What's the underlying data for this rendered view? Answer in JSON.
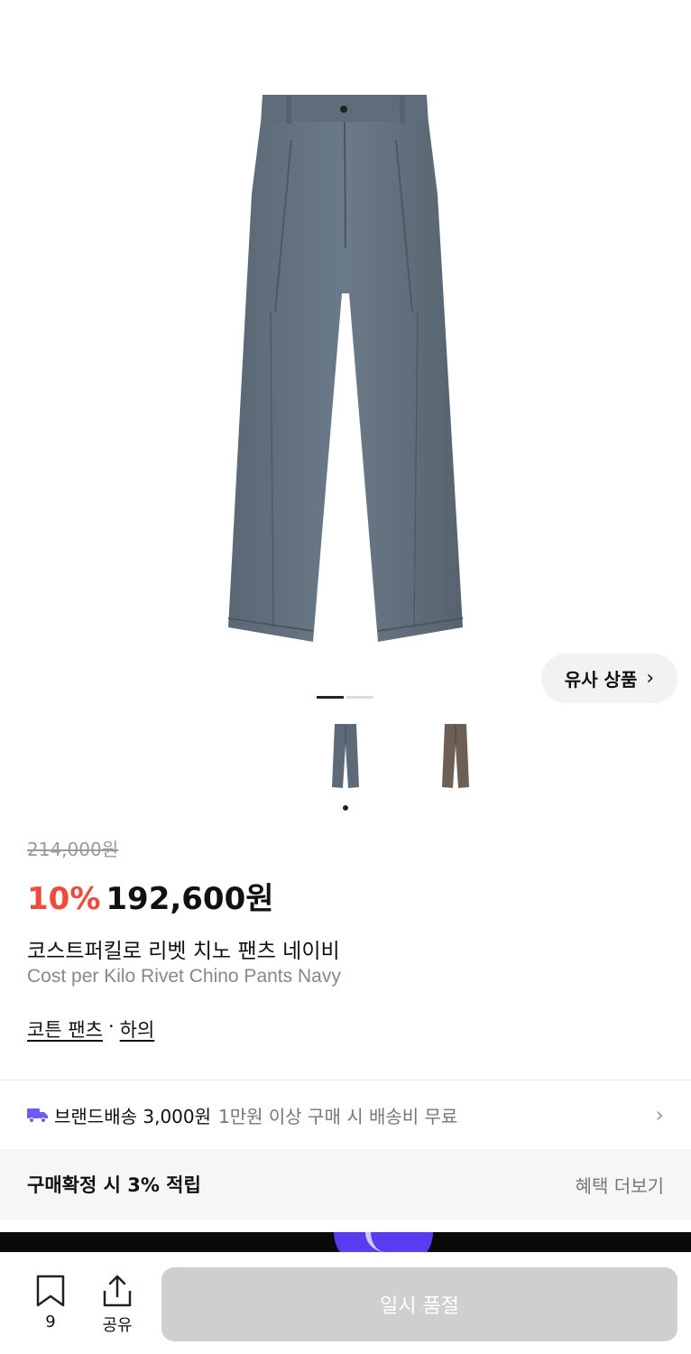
{
  "product": {
    "similar_label": "유사 상품",
    "similar_chevron": "›",
    "original_price": "214,000원",
    "discount": "10%",
    "final_price": "192,600원",
    "name_ko": "코스트퍼킬로 리벳 치노 팬츠 네이비",
    "name_en": "Cost per Kilo Rivet Chino Pants Navy",
    "categories": [
      "코튼 팬츠",
      "하의"
    ],
    "category_separator": "·",
    "image_count": 2,
    "active_image": 1,
    "colors": [
      {
        "name": "navy",
        "hex": "#5d6b78"
      },
      {
        "name": "brown",
        "hex": "#6e5f56"
      }
    ]
  },
  "shipping": {
    "brand_shipping": "브랜드배송 3,000원",
    "free_condition": "1만원 이상 구매 시 배송비 무료",
    "chevron": "›",
    "truck_color": "#6a5cf0"
  },
  "benefit": {
    "title": "구매확정 시 3% 적립",
    "more": "혜택 더보기"
  },
  "bottom_bar": {
    "bookmark_count": "9",
    "share_label": "공유",
    "soldout_label": "일시 품절"
  },
  "colors": {
    "discount": "#ef4a3c",
    "soldout_button": "#cfcfcf",
    "accent": "#5a3cf0"
  }
}
